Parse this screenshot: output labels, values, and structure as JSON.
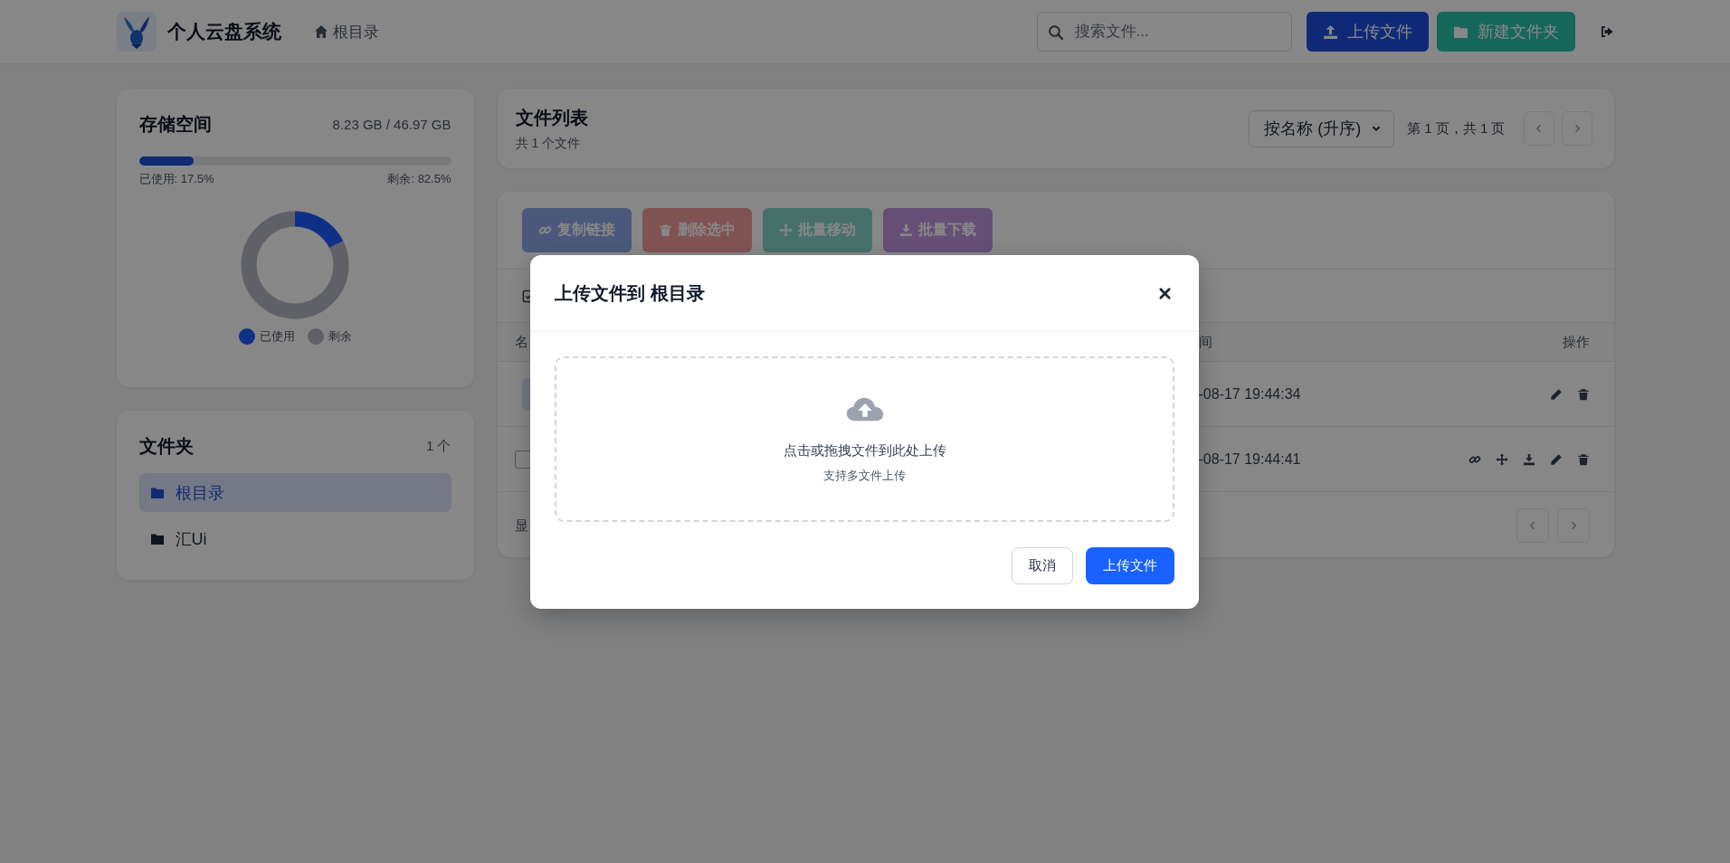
{
  "header": {
    "app_title": "个人云盘系统",
    "breadcrumb": "根目录",
    "search": {
      "placeholder": "搜索文件..."
    },
    "buttons": [
      {
        "label": "上传文件",
        "kind": "upload"
      },
      {
        "label": "新建文件夹",
        "kind": "new-folder"
      }
    ]
  },
  "storage": {
    "title": "存储空间",
    "usage": "8.23 GB / 46.97 GB",
    "level": 0.175,
    "used_label": "已使用: 17.5%",
    "free_label": "剩余: 82.5%",
    "legend": [
      {
        "label": "已使用",
        "color": "#0f3087"
      },
      {
        "label": "剩余",
        "color": "#606166"
      }
    ]
  },
  "folders": {
    "title": "文件夹",
    "count": "1 个",
    "items": [
      {
        "name": "根目录",
        "selected": true
      },
      {
        "name": "汇Ui",
        "selected": false
      }
    ]
  },
  "file_list": {
    "title": "文件列表",
    "subtitle": "共 1 个文件",
    "sort": "按名称 (升序)",
    "page_info": "第 1 页，共 1 页"
  },
  "batch_actions": [
    {
      "label": "复制链接",
      "kind": "link",
      "disabled": true
    },
    {
      "label": "删除选中",
      "kind": "delete",
      "disabled": true
    },
    {
      "label": "批量移动",
      "kind": "move",
      "disabled": true
    },
    {
      "label": "批量下载",
      "kind": "download",
      "disabled": true
    }
  ],
  "table": {
    "columns": {
      "column_1": "名",
      "column_2": "间",
      "actions": "操作"
    },
    "rows": [
      {
        "kind": "folder",
        "column_2": "-08-17 19:44:34"
      },
      {
        "kind": "file",
        "checked": false,
        "column_2": "-08-17 19:44:41"
      }
    ],
    "footer_text": "显"
  },
  "modal": {
    "title": "上传文件到 根目录",
    "drop_text": "点击或拖拽文件到此处上传",
    "drop_hint": "支持多文件上传",
    "buttons": [
      {
        "label": "取消",
        "kind": "cancel"
      },
      {
        "label": "上传文件",
        "kind": "primary"
      }
    ]
  }
}
